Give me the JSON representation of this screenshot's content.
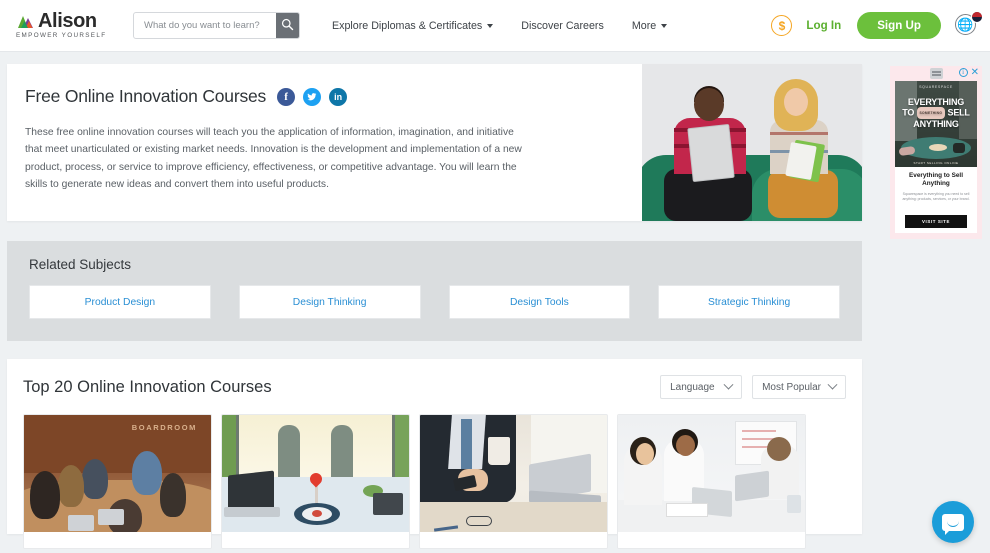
{
  "header": {
    "logo": {
      "word": "Alison",
      "tagline": "EMPOWER YOURSELF"
    },
    "search": {
      "placeholder": "What do you want to learn?",
      "value": "",
      "icon": "search-icon"
    },
    "nav": [
      {
        "label": "Explore Diplomas & Certificates",
        "has_caret": true
      },
      {
        "label": "Discover Careers",
        "has_caret": false
      },
      {
        "label": "More",
        "has_caret": true
      }
    ],
    "coin_icon": "dollar-coin-icon",
    "coin_symbol": "$",
    "login_label": "Log In",
    "signup_label": "Sign Up",
    "language_icon": "globe-icon"
  },
  "hero": {
    "title": "Free Online Innovation Courses",
    "socials": [
      {
        "name": "facebook-share-icon",
        "glyph": "f",
        "color": "#3b5998"
      },
      {
        "name": "twitter-share-icon",
        "glyph": "✒",
        "color": "#1da1f2"
      },
      {
        "name": "linkedin-share-icon",
        "glyph": "in",
        "color": "#0e76a8"
      }
    ],
    "description": "These free online innovation courses will teach you the application of information, imagination, and initiative that meet unarticulated or existing market needs. Innovation is the development and implementation of a new product, process, or service to improve efficiency, effectiveness, or competitive advantage. You will learn the skills to generate new ideas and convert them into useful products.",
    "image_alt": "Two students smiling on a green couch with a tablet and notebook"
  },
  "related": {
    "title": "Related Subjects",
    "subjects": [
      {
        "label": "Product Design"
      },
      {
        "label": "Design Thinking"
      },
      {
        "label": "Design Tools"
      },
      {
        "label": "Strategic Thinking"
      }
    ]
  },
  "courses": {
    "title": "Top 20 Online Innovation Courses",
    "filters": [
      {
        "name": "language-select",
        "value": "Language"
      },
      {
        "name": "sort-select",
        "value": "Most Popular"
      }
    ],
    "cards": [
      {
        "image_alt": "Boardroom meeting with team around a table"
      },
      {
        "image_alt": "Dartboard on a desk with laptop and handshake in background"
      },
      {
        "image_alt": "Businessman in suit holding coffee cup beside a laptop"
      },
      {
        "image_alt": "Students studying together with laptops and notebooks"
      }
    ]
  },
  "ad": {
    "brand": "SQUARESPACE",
    "headline_line1": "EVERYTHING",
    "headline_line2_a": "TO",
    "headline_pill": "SOMETHING",
    "headline_line2_b": "SELL",
    "headline_line3": "ANYTHING",
    "strip": "START SELLING ONLINE",
    "title": "Everything to Sell Anything",
    "body": "Squarespace is everything you need to sell anything: products, services, or your brand.",
    "cta": "VISIT SITE",
    "info_icon": "adchoices-info-icon",
    "close_icon": "close-icon",
    "logo_icon": "ad-network-logo-icon"
  },
  "chat": {
    "icon": "chat-bubble-icon",
    "label": "Open chat"
  }
}
